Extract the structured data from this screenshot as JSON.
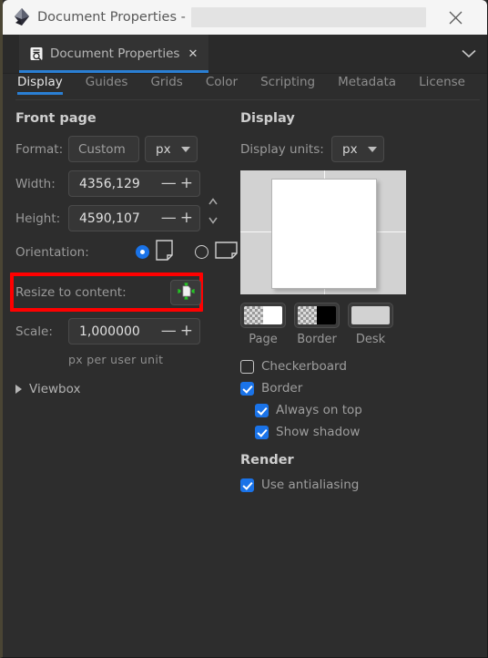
{
  "titlebar": {
    "title": "Document Properties -",
    "logo_icon": "inkscape-logo-icon",
    "close_icon": "close-icon",
    "field_value": ""
  },
  "dock": {
    "tab_label": "Document Properties",
    "tab_icon": "document-properties-icon",
    "tab_close_icon": "close-icon",
    "overflow_icon": "chevron-down-icon"
  },
  "section_tabs": [
    {
      "label": "Display",
      "active": true
    },
    {
      "label": "Guides",
      "active": false
    },
    {
      "label": "Grids",
      "active": false
    },
    {
      "label": "Color",
      "active": false
    },
    {
      "label": "Scripting",
      "active": false
    },
    {
      "label": "Metadata",
      "active": false
    },
    {
      "label": "License",
      "active": false
    }
  ],
  "front_page": {
    "heading": "Front page",
    "format_label": "Format:",
    "format_value": "Custom",
    "format_unit": "px",
    "width_label": "Width:",
    "width_value": "4356,129",
    "height_label": "Height:",
    "height_value": "4590,107",
    "minus_glyph": "—",
    "plus_glyph": "+",
    "link_icon": "link-dimensions-icon",
    "orientation_label": "Orientation:",
    "orientation_portrait_selected": true,
    "orientation_landscape_selected": false,
    "portrait_icon": "page-portrait-icon",
    "landscape_icon": "page-landscape-icon",
    "resize_label": "Resize to content:",
    "resize_icon": "resize-page-to-content-icon",
    "scale_label": "Scale:",
    "scale_value": "1,000000",
    "scale_hint": "px per user unit",
    "viewbox_label": "Viewbox",
    "viewbox_expanded": false,
    "highlight_color": "#ff0000"
  },
  "display": {
    "heading": "Display",
    "units_label": "Display units:",
    "units_value": "px",
    "swatches": [
      {
        "label": "Page",
        "kind": "checker-white"
      },
      {
        "label": "Border",
        "kind": "checker-black"
      },
      {
        "label": "Desk",
        "kind": "solid-gray"
      }
    ],
    "checkboxes": [
      {
        "label": "Checkerboard",
        "checked": false,
        "indent": false
      },
      {
        "label": "Border",
        "checked": true,
        "indent": false
      },
      {
        "label": "Always on top",
        "checked": true,
        "indent": true
      },
      {
        "label": "Show shadow",
        "checked": true,
        "indent": true
      }
    ],
    "render_heading": "Render",
    "render_checkbox": {
      "label": "Use antialiasing",
      "checked": true
    }
  },
  "theme": {
    "accent": "#2a7fd4",
    "checkbox_blue": "#1a73e8",
    "background": "#2d2d2d",
    "titlebar_bg": "#f5f5f5"
  }
}
